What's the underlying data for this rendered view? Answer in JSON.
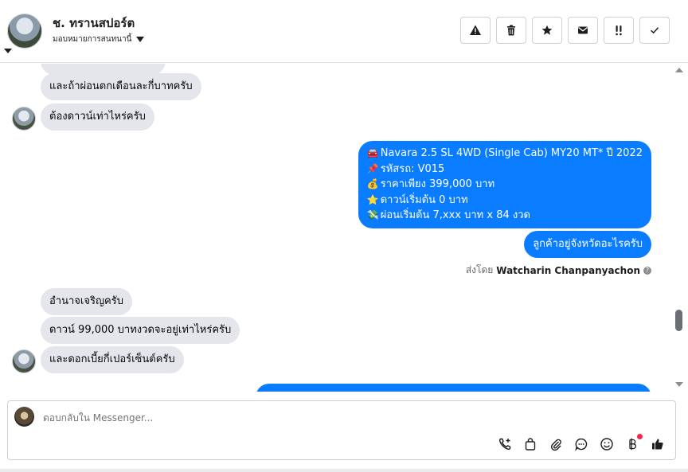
{
  "header": {
    "contact_name": "ช. ทรานสปอร์ต",
    "assign_label": "มอบหมายการสนทนานี้",
    "actions": [
      {
        "name": "warning-icon",
        "glyph": "!"
      },
      {
        "name": "trash-icon",
        "glyph": "🗑"
      },
      {
        "name": "star-icon",
        "glyph": "★"
      },
      {
        "name": "envelope-icon",
        "glyph": "✉"
      },
      {
        "name": "priority-icon",
        "glyph": "!!"
      },
      {
        "name": "check-icon",
        "glyph": "✓"
      }
    ]
  },
  "messages": {
    "in1": "และถ้าผ่อนตกเดือนละกี่บาทครับ",
    "in2": "ต้องดาวน์เท่าไหร่ครับ",
    "card": {
      "line1": "Navara 2.5 SL 4WD (Single Cab) MY20 MT* ปี 2022",
      "line2": "รหัสรถ: V015",
      "line3": "ราคาเพียง 399,000 บาท",
      "line4": "ดาวน์เริ่มต้น 0 บาท",
      "line5": "ผ่อนเริ่มต้น 7,xxx บาท x 84 งวด",
      "icon1": "🚘",
      "icon2": "📌",
      "icon3": "💰",
      "icon4": "⭐",
      "icon5": "💸"
    },
    "out2": "ลูกค้าอยู่จังหวัดอะไรครับ",
    "sent_by_label": "ส่งโดย",
    "sent_by_name": "Watcharin Chanpanyachon",
    "in3": "อำนาจเจริญครับ",
    "in4": "ดาวน์ 99,000 บาทงวดจะอยู่เท่าไหร่ครับ",
    "in5": "และดอกเบี้ยกี่เปอร์เซ็นต์ครับ"
  },
  "composer": {
    "placeholder": "ตอบกลับใน Messenger..."
  },
  "colors": {
    "outgoing_bubble": "#0a7cff",
    "incoming_bubble": "#e4e6eb",
    "notification_dot": "#f02849"
  }
}
